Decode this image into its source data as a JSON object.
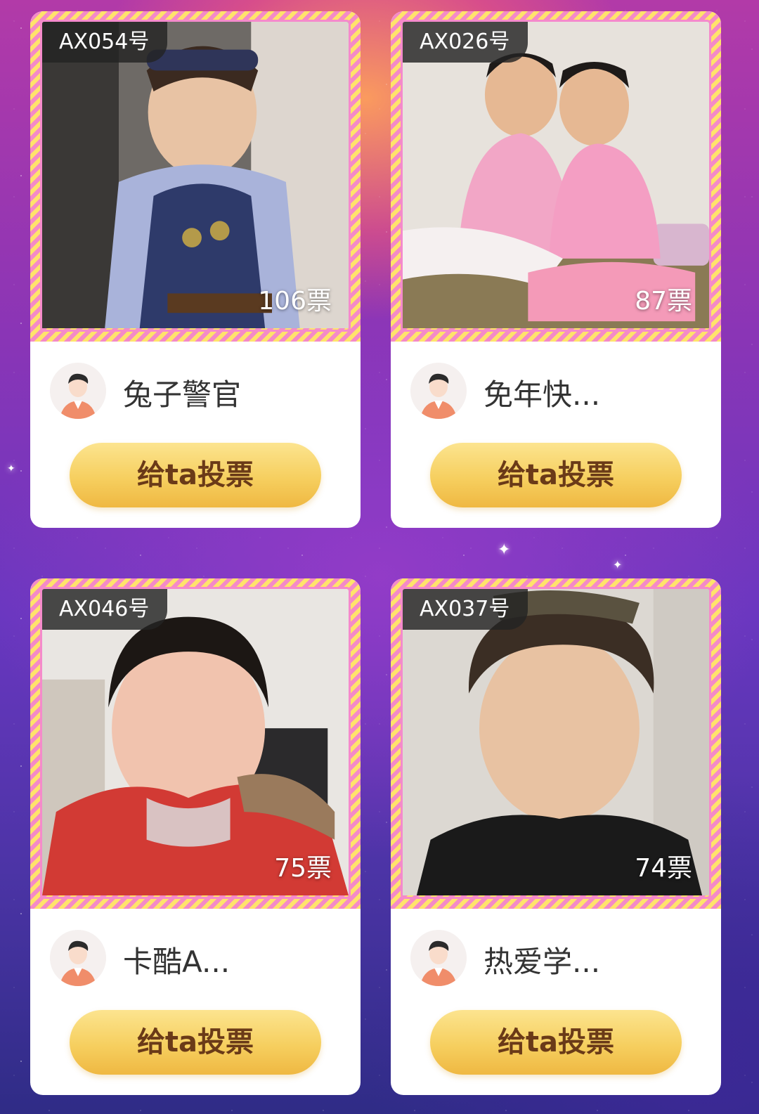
{
  "cards": [
    {
      "id": "AX054号",
      "votes": "106票",
      "name": "兔子警官",
      "button": "给ta投票"
    },
    {
      "id": "AX026号",
      "votes": "87票",
      "name": "免年快...",
      "button": "给ta投票"
    },
    {
      "id": "AX046号",
      "votes": "75票",
      "name": "卡酷A...",
      "button": "给ta投票"
    },
    {
      "id": "AX037号",
      "votes": "74票",
      "name": "热爱学...",
      "button": "给ta投票"
    }
  ],
  "colors": {
    "vote_button": "#f6cf5f",
    "frame_pink": "#f48ac7",
    "frame_yellow": "#ffe36b"
  }
}
